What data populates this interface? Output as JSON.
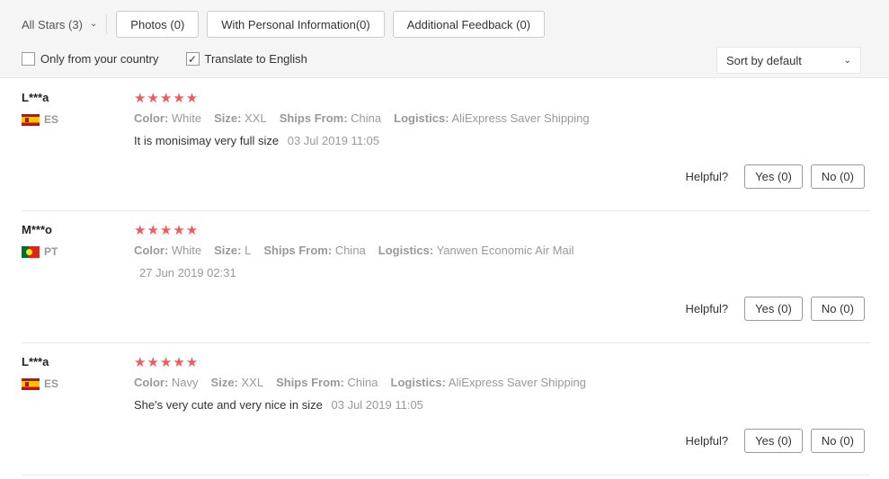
{
  "filters": {
    "all_stars": "All Stars (3)",
    "buttons": [
      "Photos (0)",
      "With Personal Information(0)",
      "Additional Feedback (0)"
    ]
  },
  "options": {
    "only_country": "Only from your country",
    "only_country_checked": false,
    "translate": "Translate to English",
    "translate_checked": true
  },
  "sort": {
    "label": "Sort by default"
  },
  "helpful_label": "Helpful?",
  "reviews": [
    {
      "user": "L***a",
      "country": "ES",
      "rating": 5,
      "stars": "★★★★★",
      "color_label": "Color:",
      "color": "White",
      "size_label": "Size:",
      "size": "XXL",
      "ships_label": "Ships From:",
      "ships": "China",
      "logistics_label": "Logistics:",
      "logistics": "AliExpress Saver Shipping",
      "text": "It is monisimay very full size",
      "date": "03 Jul 2019 11:05",
      "yes": "Yes (0)",
      "no": "No (0)"
    },
    {
      "user": "M***o",
      "country": "PT",
      "rating": 5,
      "stars": "★★★★★",
      "color_label": "Color:",
      "color": "White",
      "size_label": "Size:",
      "size": "L",
      "ships_label": "Ships From:",
      "ships": "China",
      "logistics_label": "Logistics:",
      "logistics": "Yanwen Economic Air Mail",
      "text": "",
      "date": "27 Jun 2019 02:31",
      "yes": "Yes (0)",
      "no": "No (0)"
    },
    {
      "user": "L***a",
      "country": "ES",
      "rating": 5,
      "stars": "★★★★★",
      "color_label": "Color:",
      "color": "Navy",
      "size_label": "Size:",
      "size": "XXL",
      "ships_label": "Ships From:",
      "ships": "China",
      "logistics_label": "Logistics:",
      "logistics": "AliExpress Saver Shipping",
      "text": "She's very cute and very nice in size",
      "date": "03 Jul 2019 11:05",
      "yes": "Yes (0)",
      "no": "No (0)"
    }
  ],
  "colors": {
    "star": "#f05a5a",
    "muted": "#999999",
    "topbar_bg": "#f5f5f5"
  }
}
